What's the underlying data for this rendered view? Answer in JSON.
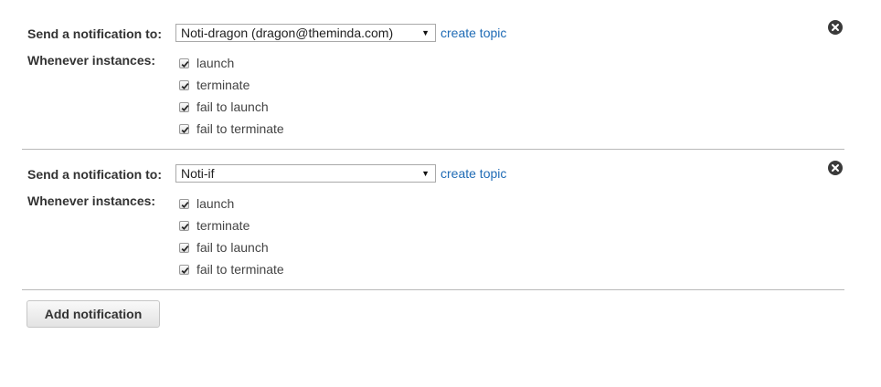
{
  "notifications": [
    {
      "send_label": "Send a notification to:",
      "topic": "Noti-dragon (dragon@theminda.com)",
      "create_topic_label": "create topic",
      "whenever_label": "Whenever instances:",
      "options": [
        {
          "label": "launch",
          "checked": true
        },
        {
          "label": "terminate",
          "checked": true
        },
        {
          "label": "fail to launch",
          "checked": true
        },
        {
          "label": "fail to terminate",
          "checked": true
        }
      ]
    },
    {
      "send_label": "Send a notification to:",
      "topic": "Noti-if",
      "create_topic_label": "create topic",
      "whenever_label": "Whenever instances:",
      "options": [
        {
          "label": "launch",
          "checked": true
        },
        {
          "label": "terminate",
          "checked": true
        },
        {
          "label": "fail to launch",
          "checked": true
        },
        {
          "label": "fail to terminate",
          "checked": true
        }
      ]
    }
  ],
  "add_notification_label": "Add notification",
  "icons": {
    "remove": "close-circle-icon",
    "dropdown": "chevron-down-icon",
    "check": "checkmark-icon"
  },
  "colors": {
    "link": "#1f6bb5",
    "label": "#333333",
    "divider": "#b9b9b9"
  }
}
